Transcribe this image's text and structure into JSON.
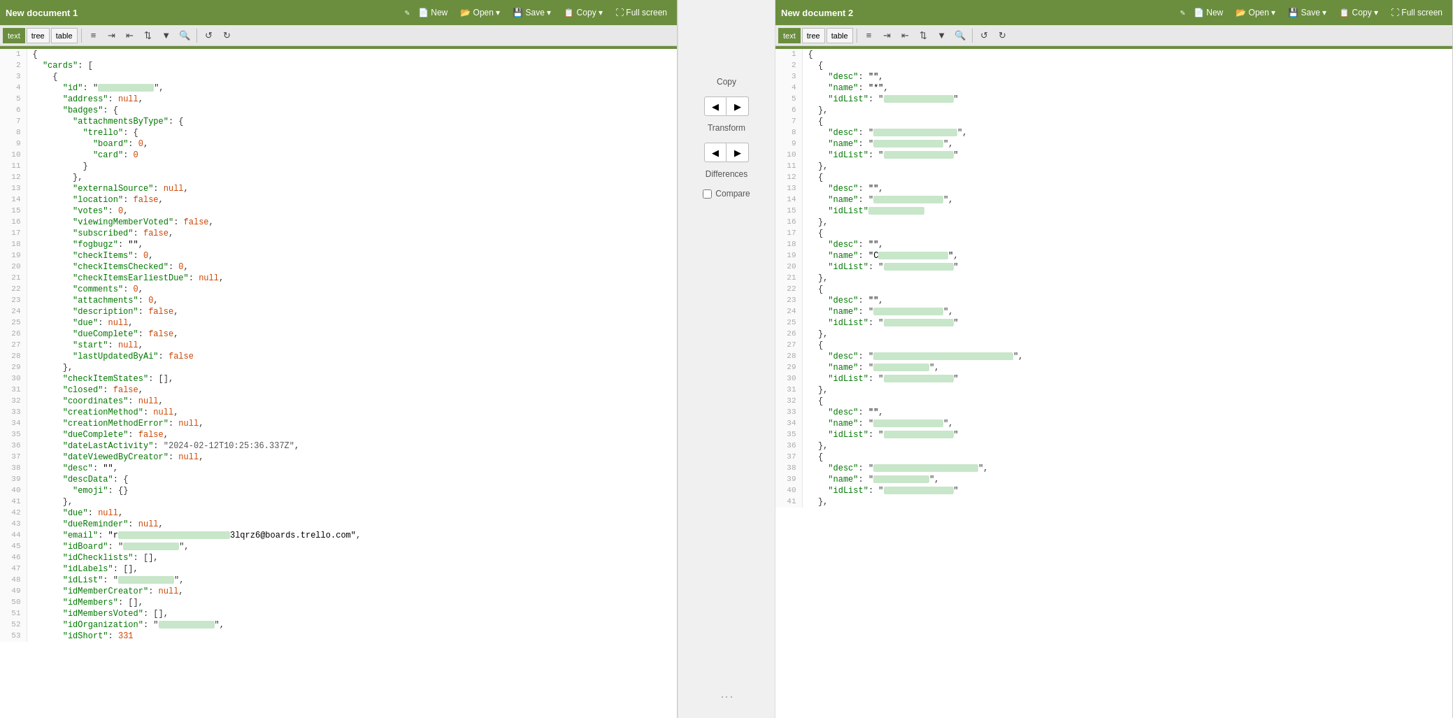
{
  "doc1": {
    "title": "New document 1",
    "edit_icon": "✎",
    "toolbar_tabs": [
      "text",
      "tree",
      "table"
    ],
    "active_tab": "text",
    "btns": [
      "New",
      "Open ▾",
      "Save ▾",
      "Copy ▾",
      "Full screen"
    ],
    "lines": [
      {
        "num": 1,
        "text": "{"
      },
      {
        "num": 2,
        "text": "  \"cards\": ["
      },
      {
        "num": 3,
        "text": "    {"
      },
      {
        "num": 4,
        "text": "      \"id\": \"",
        "blurred": true,
        "after": "\","
      },
      {
        "num": 5,
        "text": "      \"address\": null,"
      },
      {
        "num": 6,
        "text": "      \"badges\": {"
      },
      {
        "num": 7,
        "text": "        \"attachmentsByType\": {"
      },
      {
        "num": 8,
        "text": "          \"trello\": {"
      },
      {
        "num": 9,
        "text": "            \"board\": 0,"
      },
      {
        "num": 10,
        "text": "            \"card\": 0"
      },
      {
        "num": 11,
        "text": "          }"
      },
      {
        "num": 12,
        "text": "        },"
      },
      {
        "num": 13,
        "text": "        \"externalSource\": null,"
      },
      {
        "num": 14,
        "text": "        \"location\": false,"
      },
      {
        "num": 15,
        "text": "        \"votes\": 0,"
      },
      {
        "num": 16,
        "text": "        \"viewingMemberVoted\": false,"
      },
      {
        "num": 17,
        "text": "        \"subscribed\": false,"
      },
      {
        "num": 18,
        "text": "        \"fogbugz\": \"\","
      },
      {
        "num": 19,
        "text": "        \"checkItems\": 0,"
      },
      {
        "num": 20,
        "text": "        \"checkItemsChecked\": 0,"
      },
      {
        "num": 21,
        "text": "        \"checkItemsEarliestDue\": null,"
      },
      {
        "num": 22,
        "text": "        \"comments\": 0,"
      },
      {
        "num": 23,
        "text": "        \"attachments\": 0,"
      },
      {
        "num": 24,
        "text": "        \"description\": false,"
      },
      {
        "num": 25,
        "text": "        \"due\": null,"
      },
      {
        "num": 26,
        "text": "        \"dueComplete\": false,"
      },
      {
        "num": 27,
        "text": "        \"start\": null,"
      },
      {
        "num": 28,
        "text": "        \"lastUpdatedByAi\": false"
      },
      {
        "num": 29,
        "text": "      },"
      },
      {
        "num": 30,
        "text": "      \"checkItemStates\": [],"
      },
      {
        "num": 31,
        "text": "      \"closed\": false,"
      },
      {
        "num": 32,
        "text": "      \"coordinates\": null,"
      },
      {
        "num": 33,
        "text": "      \"creationMethod\": null,"
      },
      {
        "num": 34,
        "text": "      \"creationMethodError\": null,"
      },
      {
        "num": 35,
        "text": "      \"dueComplete\": false,"
      },
      {
        "num": 36,
        "text": "      \"dateLastActivity\": \"2024-02-12T10:25:36.337Z\","
      },
      {
        "num": 37,
        "text": "      \"dateViewedByCreator\": null,"
      },
      {
        "num": 38,
        "text": "      \"desc\": \"\","
      },
      {
        "num": 39,
        "text": "      \"descData\": {"
      },
      {
        "num": 40,
        "text": "        \"emoji\": {}"
      },
      {
        "num": 41,
        "text": "      },"
      },
      {
        "num": 42,
        "text": "      \"due\": null,"
      },
      {
        "num": 43,
        "text": "      \"dueReminder\": null,"
      },
      {
        "num": 44,
        "text": "      \"email\": \"r",
        "blurred2": true,
        "after2": "3lqrz6@boards.trello.com\","
      },
      {
        "num": 45,
        "text": "      \"idBoard\": \"",
        "blurred": true,
        "after": "\","
      },
      {
        "num": 46,
        "text": "      \"idChecklists\": [],"
      },
      {
        "num": 47,
        "text": "      \"idLabels\": [],"
      },
      {
        "num": 48,
        "text": "      \"idList\": \"",
        "blurred": true,
        "after": "\","
      },
      {
        "num": 49,
        "text": "      \"idMemberCreator\": null,"
      },
      {
        "num": 50,
        "text": "      \"idMembers\": [],"
      },
      {
        "num": 51,
        "text": "      \"idMembersVoted\": [],"
      },
      {
        "num": 52,
        "text": "      \"idOrganization\": \"",
        "blurred": true,
        "after": "\","
      },
      {
        "num": 53,
        "text": "      \"idShort\": 331"
      }
    ]
  },
  "doc2": {
    "title": "New document 2",
    "edit_icon": "✎",
    "toolbar_tabs": [
      "text",
      "tree",
      "table"
    ],
    "active_tab": "text",
    "btns": [
      "New",
      "Open ▾",
      "Save ▾",
      "Copy ▾",
      "Full screen"
    ],
    "lines": [
      {
        "num": 1,
        "text": "{"
      },
      {
        "num": 2,
        "text": "  {"
      },
      {
        "num": 3,
        "text": "    \"desc\": \"\","
      },
      {
        "num": 4,
        "text": "    \"name\": \"*\","
      },
      {
        "num": 5,
        "text": "    \"idList\": \"",
        "blurred": true,
        "after": "\""
      },
      {
        "num": 6,
        "text": "  },"
      },
      {
        "num": 7,
        "text": "  {"
      },
      {
        "num": 8,
        "text": "    \"desc\": \"",
        "blurred": true,
        "after": "\","
      },
      {
        "num": 9,
        "text": "    \"name\": \"",
        "blurred": true,
        "after": "\","
      },
      {
        "num": 10,
        "text": "    \"idList\": \"",
        "blurred": true,
        "after": "\""
      },
      {
        "num": 11,
        "text": "  },"
      },
      {
        "num": 12,
        "text": "  {"
      },
      {
        "num": 13,
        "text": "    \"desc\": \"\","
      },
      {
        "num": 14,
        "text": "    \"name\": \"",
        "blurred": true,
        "after": "\","
      },
      {
        "num": 15,
        "text": "    \"idList\"",
        "blurred": true,
        "after": ""
      },
      {
        "num": 16,
        "text": "  },"
      },
      {
        "num": 17,
        "text": "  {"
      },
      {
        "num": 18,
        "text": "    \"desc\": \"\","
      },
      {
        "num": 19,
        "text": "    \"name\": \"C",
        "blurred": true,
        "after": "\","
      },
      {
        "num": 20,
        "text": "    \"idList\": \"",
        "blurred": true,
        "after": "\""
      },
      {
        "num": 21,
        "text": "  },"
      },
      {
        "num": 22,
        "text": "  {"
      },
      {
        "num": 23,
        "text": "    \"desc\": \"\","
      },
      {
        "num": 24,
        "text": "    \"name\": \"",
        "blurred": true,
        "after": "\","
      },
      {
        "num": 25,
        "text": "    \"idList\": \"",
        "blurred": true,
        "after": "\""
      },
      {
        "num": 26,
        "text": "  },"
      },
      {
        "num": 27,
        "text": "  {"
      },
      {
        "num": 28,
        "text": "    \"desc\": \"",
        "blurred": true,
        "after": "\","
      },
      {
        "num": 29,
        "text": "    \"name\": \"",
        "blurred": true,
        "after": "\","
      },
      {
        "num": 30,
        "text": "    \"idList\": \"",
        "blurred": true,
        "after": "\""
      },
      {
        "num": 31,
        "text": "  },"
      },
      {
        "num": 32,
        "text": "  {"
      },
      {
        "num": 33,
        "text": "    \"desc\": \"\","
      },
      {
        "num": 34,
        "text": "    \"name\": \"",
        "blurred": true,
        "after": "\","
      },
      {
        "num": 35,
        "text": "    \"idList\": \"",
        "blurred": true,
        "after": "\""
      },
      {
        "num": 36,
        "text": "  },"
      },
      {
        "num": 37,
        "text": "  {"
      },
      {
        "num": 38,
        "text": "    \"desc\": \"",
        "blurred": true,
        "after": "\","
      },
      {
        "num": 39,
        "text": "    \"name\": \"",
        "blurred": true,
        "after": "\","
      },
      {
        "num": 40,
        "text": "    \"idList\": \"",
        "blurred": true,
        "after": "\""
      },
      {
        "num": 41,
        "text": "  },"
      }
    ]
  },
  "divider": {
    "copy_label": "Copy",
    "left_arrow": "◀",
    "right_arrow": "▶",
    "transform_label": "Transform",
    "differences_label": "Differences",
    "compare_label": "Compare"
  },
  "icons": {
    "new": "📄",
    "open": "📂",
    "save": "💾",
    "copy": "📋",
    "fullscreen": "⛶",
    "edit": "✎",
    "indent_more": "⇥",
    "indent_less": "⇤",
    "format": "☰",
    "sort": "⇅",
    "filter": "▼",
    "search": "🔍",
    "undo": "↺",
    "redo": "↻"
  }
}
